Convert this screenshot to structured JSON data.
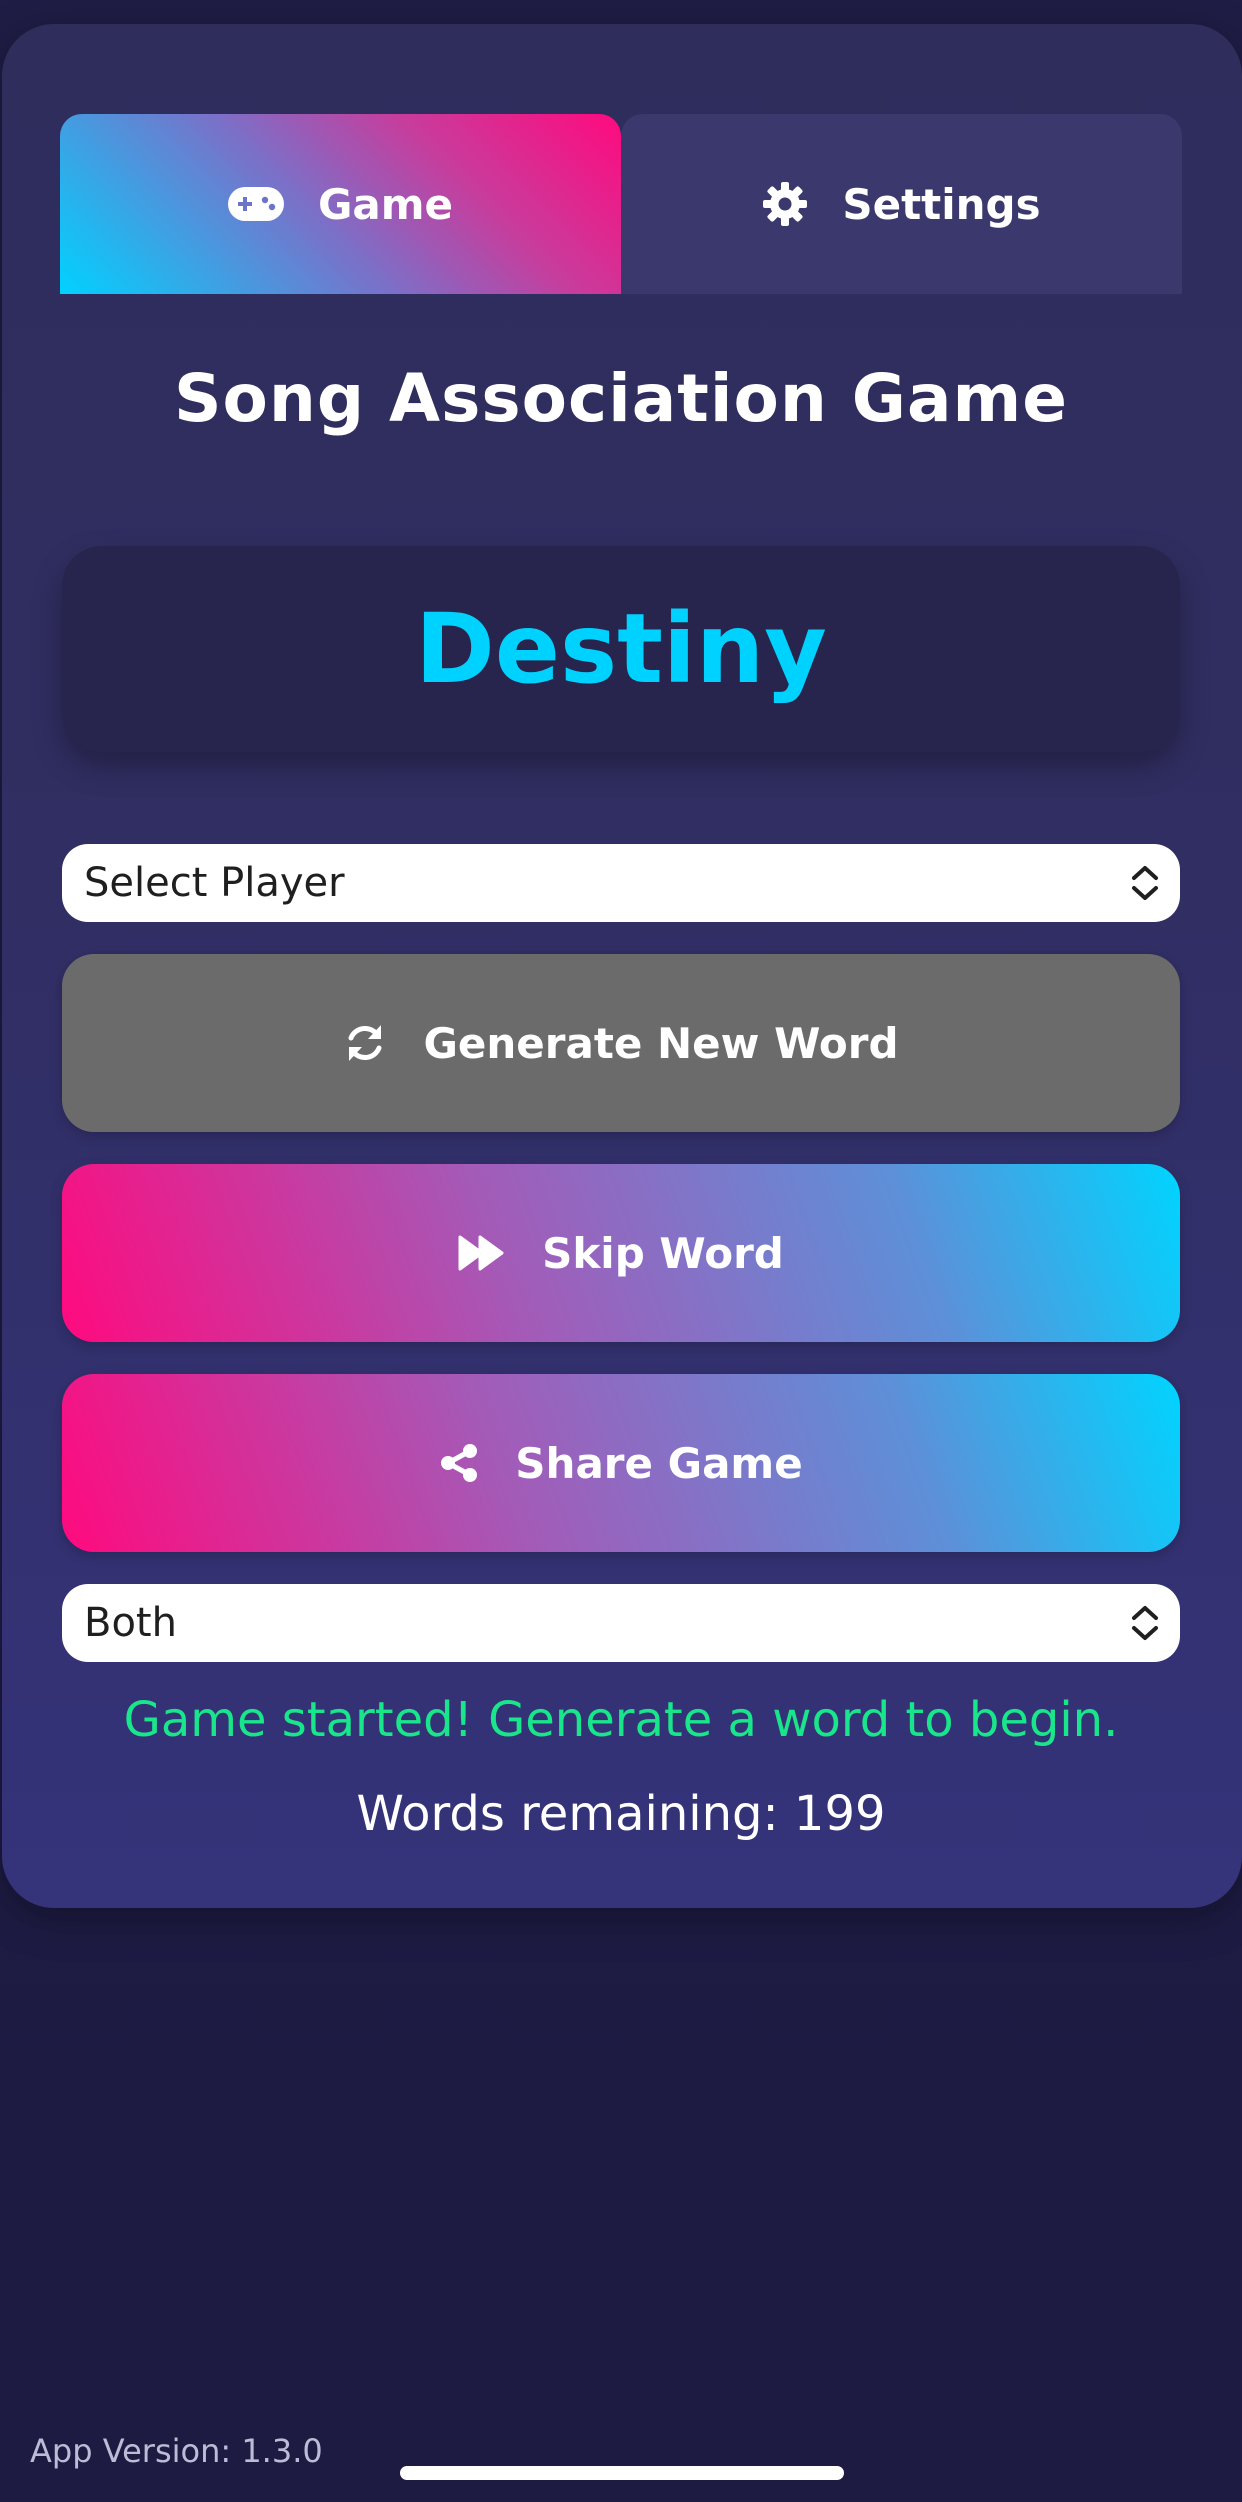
{
  "tabs": [
    {
      "label": "Game",
      "icon": "gamepad-icon",
      "active": true
    },
    {
      "label": "Settings",
      "icon": "gear-icon",
      "active": false
    }
  ],
  "title": "Song Association Game",
  "current_word": "Destiny",
  "player_select": {
    "value": "Select Player"
  },
  "buttons": {
    "generate": {
      "label": "Generate New Word",
      "icon": "refresh-icon"
    },
    "skip": {
      "label": "Skip Word",
      "icon": "fast-forward-icon"
    },
    "share": {
      "label": "Share Game",
      "icon": "share-icon"
    }
  },
  "mode_select": {
    "value": "Both"
  },
  "status_text": "Game started! Generate a word to begin.",
  "words_remaining": "Words remaining: 199",
  "app_version": "App Version: 1.3.0",
  "colors": {
    "accent_cyan": "#00d2ff",
    "accent_pink": "#ff0a7e",
    "status_green": "#19e58a",
    "generate_gray": "#6b6b6b"
  }
}
